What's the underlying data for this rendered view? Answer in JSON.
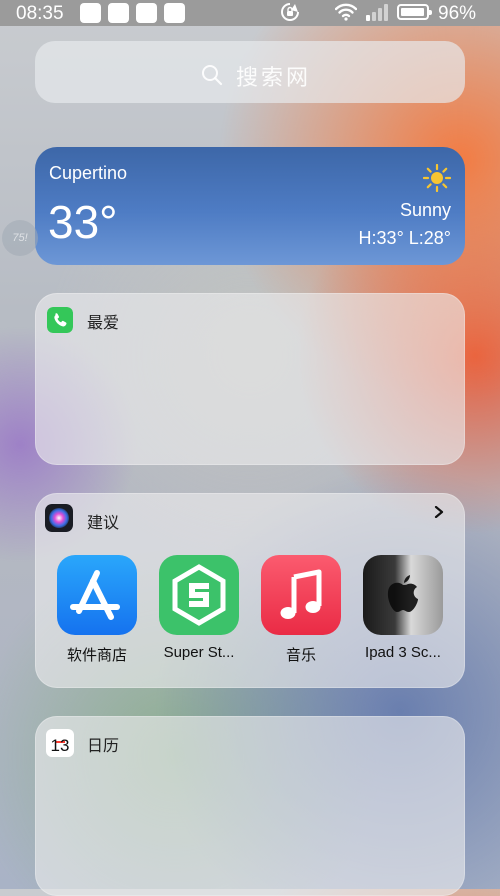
{
  "status_bar": {
    "time": "08:35",
    "battery_percent": "96%",
    "battery_level": 0.96
  },
  "search": {
    "placeholder": "搜索网"
  },
  "weather": {
    "city": "Cupertino",
    "temperature": "33°",
    "condition": "Sunny",
    "high_low": "H:33° L:28°",
    "icon": "sun-icon"
  },
  "overlay_bubble": {
    "text": "75!"
  },
  "favorites": {
    "title": "最爱",
    "icon": "phone-icon"
  },
  "suggestions": {
    "title": "建议",
    "icon": "siri-icon",
    "apps": [
      {
        "label": "软件商店",
        "icon": "app-store-icon"
      },
      {
        "label": "Super St...",
        "icon": "super-s-icon"
      },
      {
        "label": "音乐",
        "icon": "music-icon"
      },
      {
        "label": "Ipad 3 Sc...",
        "icon": "apple-logo-icon"
      }
    ]
  },
  "calendar": {
    "title": "日历",
    "day": "13",
    "icon": "calendar-icon"
  },
  "colors": {
    "weather_top": "#3d67a8",
    "weather_bottom": "#6d97d6",
    "phone_green": "#34c759",
    "app_store_blue": "#1c8cf5",
    "music_red": "#f23b52",
    "super_s_green": "#3cc26a"
  }
}
